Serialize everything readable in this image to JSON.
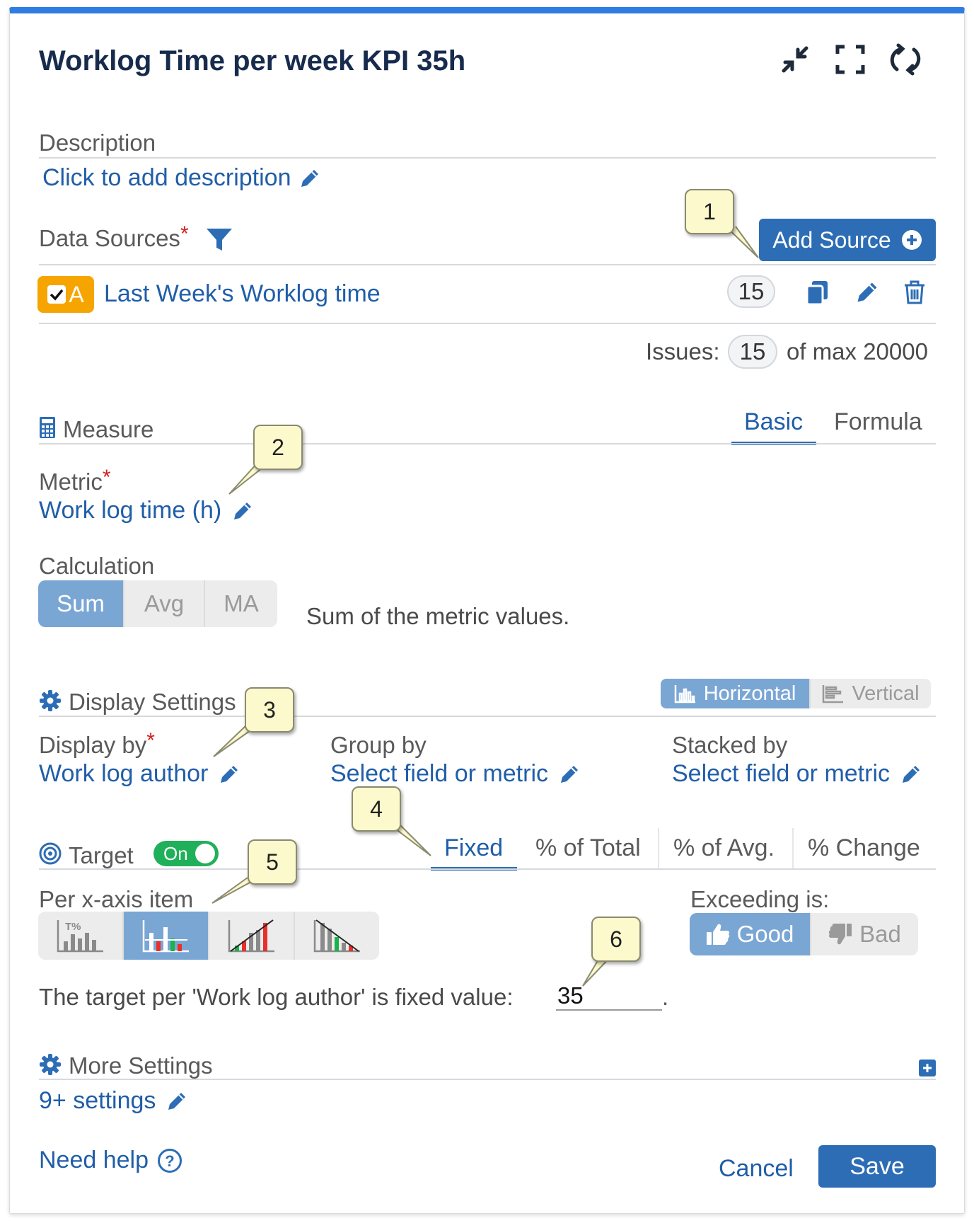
{
  "header": {
    "title": "Worklog Time per week KPI 35h"
  },
  "description": {
    "label": "Description",
    "link": "Click to add description"
  },
  "data_sources": {
    "label": "Data Sources",
    "required_mark": "*",
    "add_button": "Add Source",
    "source": {
      "badge": "A",
      "name": "Last Week's Worklog time",
      "count": "15"
    },
    "issues_label": "Issues:",
    "issues_count": "15",
    "issues_max": "of max 20000"
  },
  "measure": {
    "label": "Measure",
    "tabs": [
      "Basic",
      "Formula"
    ],
    "metric_label": "Metric",
    "metric_value": "Work log time (h)",
    "calculation_label": "Calculation",
    "calc_options": [
      "Sum",
      "Avg",
      "MA"
    ],
    "calc_selected": "Sum",
    "calc_description": "Sum of the metric values."
  },
  "display_settings": {
    "label": "Display Settings",
    "orientation": [
      "Horizontal",
      "Vertical"
    ],
    "orientation_selected": "Horizontal",
    "display_by_label": "Display by",
    "display_by_value": "Work log author",
    "group_by_label": "Group by",
    "group_by_value": "Select field or metric",
    "stacked_by_label": "Stacked by",
    "stacked_by_value": "Select field or metric"
  },
  "target": {
    "label": "Target",
    "toggle": "On",
    "tabs": [
      "Fixed",
      "% of Total",
      "% of Avg.",
      "% Change"
    ],
    "active_tab": "Fixed",
    "per_label": "Per x-axis item",
    "chart_icon_label": "T%",
    "exceeding_label": "Exceeding is:",
    "exceeding_options": [
      "Good",
      "Bad"
    ],
    "exceeding_selected": "Good",
    "fixed_text": "The target per 'Work log author' is fixed value:",
    "fixed_value": "35",
    "fixed_suffix": "."
  },
  "more_settings": {
    "label": "More Settings",
    "link": "9+ settings"
  },
  "footer": {
    "help": "Need help",
    "cancel": "Cancel",
    "save": "Save"
  },
  "callouts": [
    "1",
    "2",
    "3",
    "4",
    "5",
    "6"
  ],
  "colors": {
    "accent": "#2d6db5",
    "link": "#205ea8",
    "selected_segment": "#7aa6d4",
    "toggle_on": "#21b05a",
    "badge": "#f6a400",
    "callout_bg": "#fcfacc"
  }
}
